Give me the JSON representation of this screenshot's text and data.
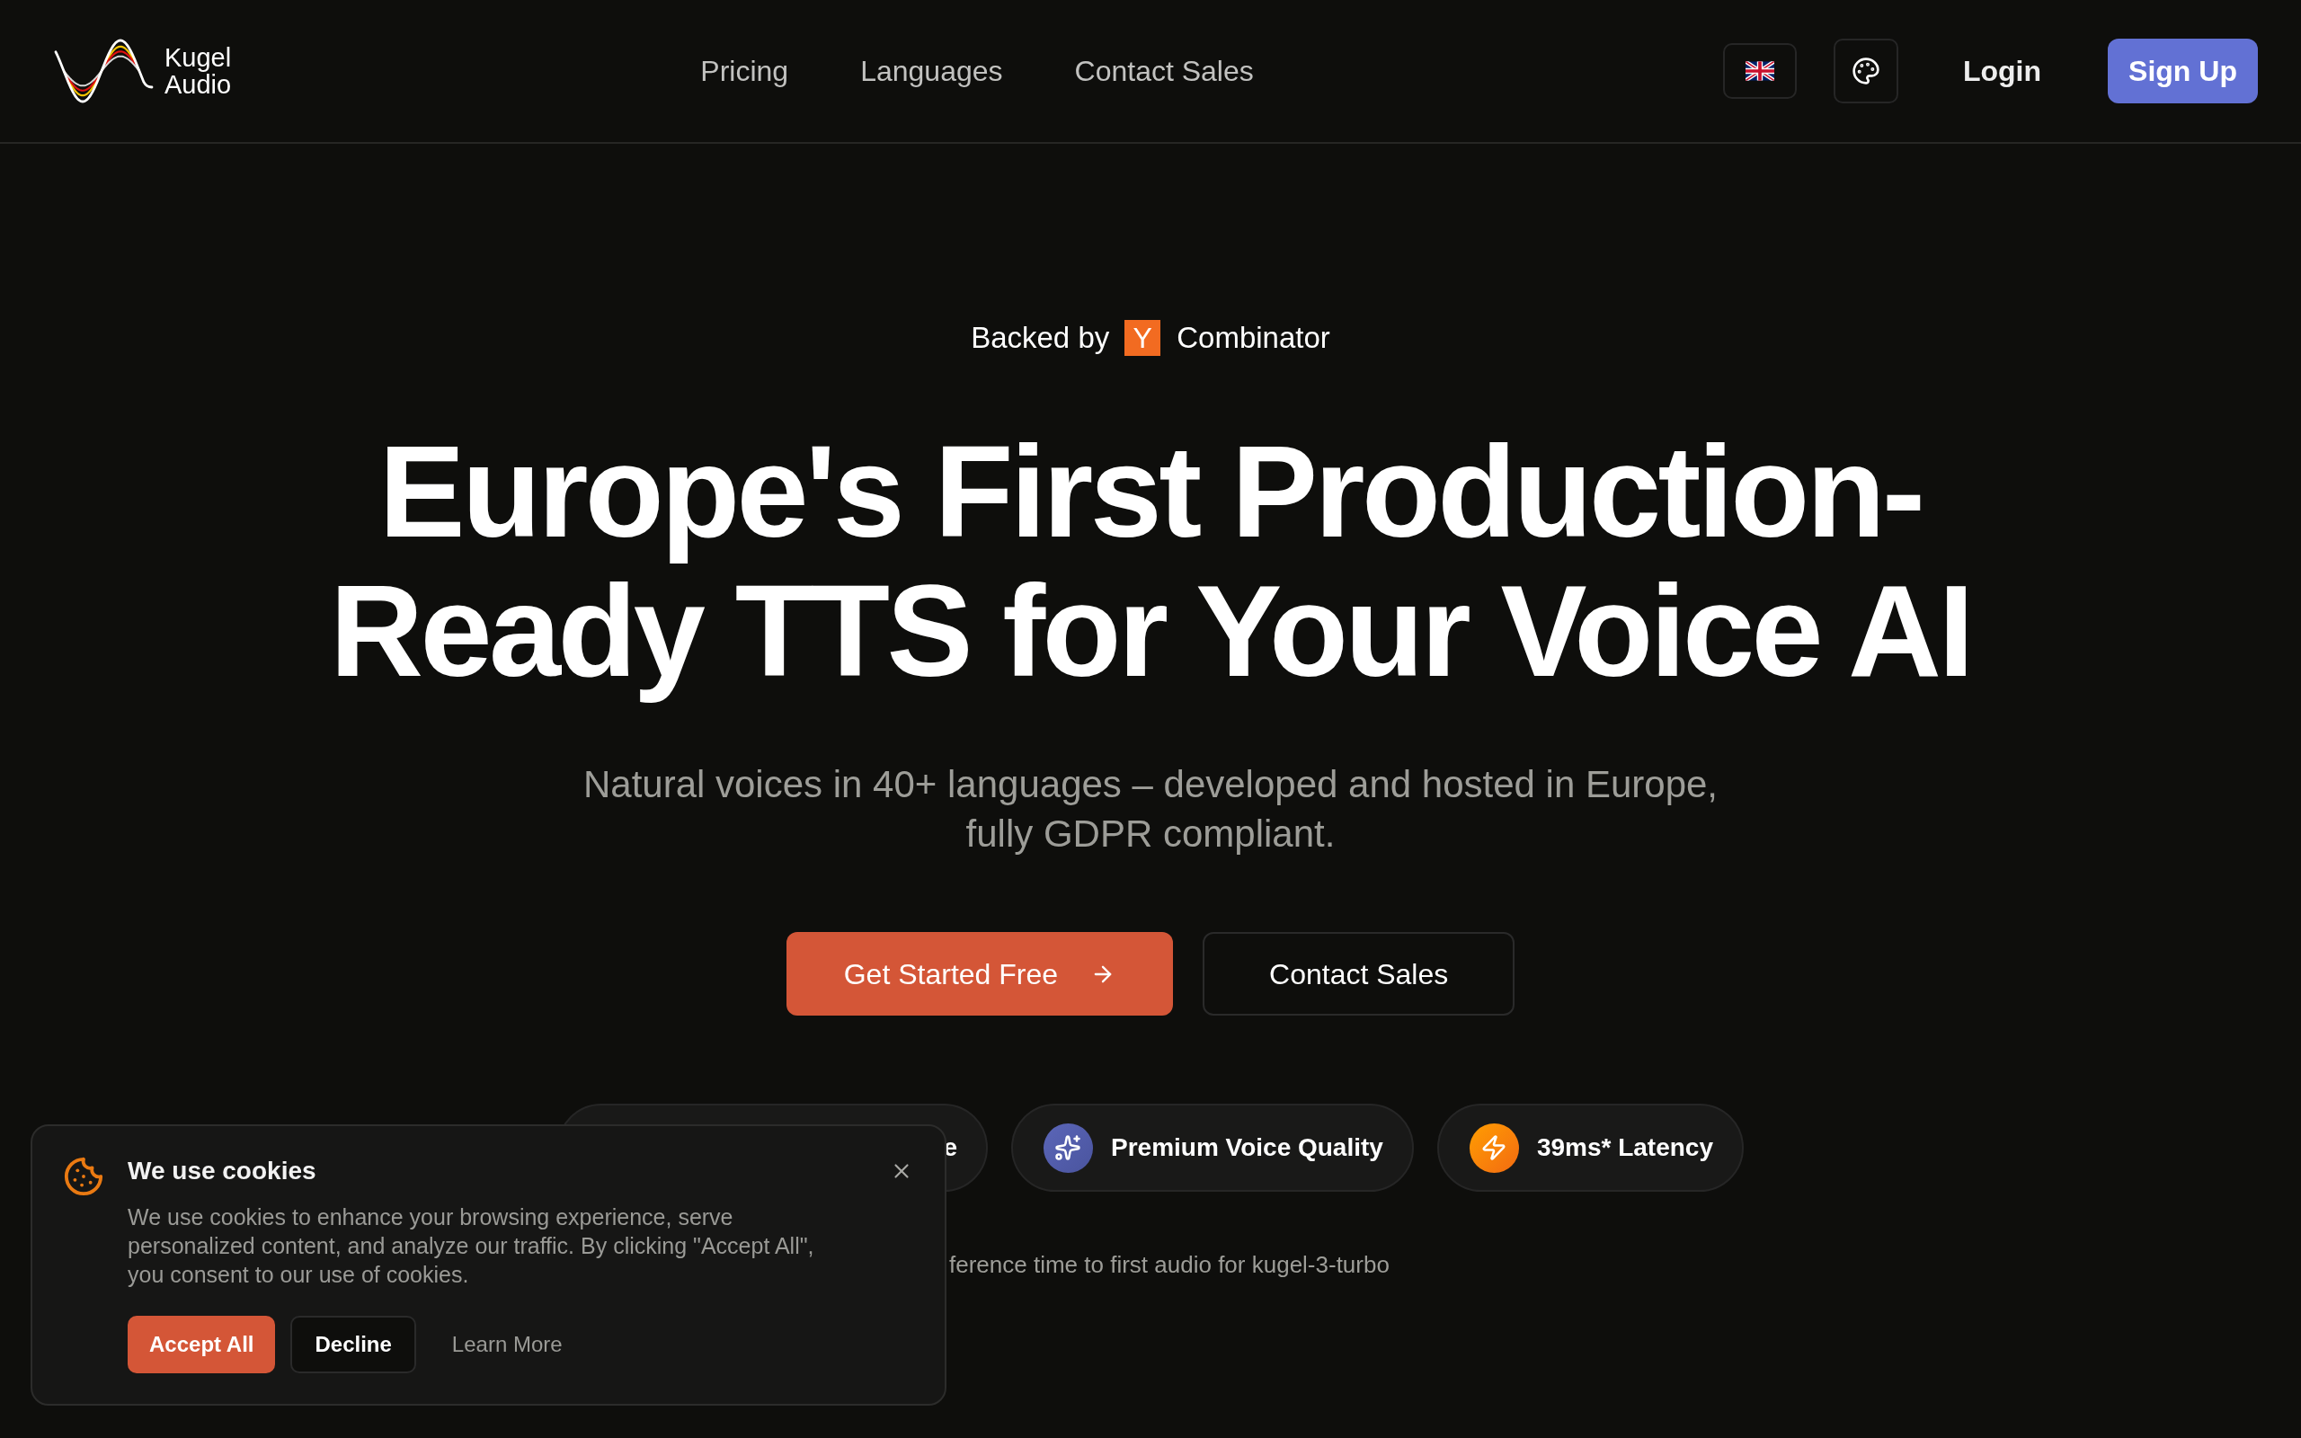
{
  "header": {
    "brand": [
      "Kugel",
      "Audio"
    ],
    "nav": [
      "Pricing",
      "Languages",
      "Contact Sales"
    ],
    "login": "Login",
    "signup": "Sign Up"
  },
  "hero": {
    "backed": {
      "prefix": "Backed by",
      "letter": "Y",
      "suffix": "Combinator"
    },
    "headline": [
      "Europe's First Production-",
      "Ready TTS for Your Voice AI"
    ],
    "subtitle": "Natural voices in 40+ languages – developed and hosted in Europe, fully GDPR compliant.",
    "buttons": [
      {
        "kind": "primary",
        "label": "Get Started Free"
      },
      {
        "kind": "secondary",
        "label": "Contact Sales"
      }
    ],
    "features": [
      {
        "kind": "plain",
        "label": "e"
      },
      {
        "kind": "quality",
        "label": "Premium Voice Quality"
      },
      {
        "kind": "speed",
        "label": "39ms* Latency"
      }
    ],
    "footnote": "ference time to first audio for kugel-3-turbo"
  },
  "cookie_banner": {
    "title": "We use cookies",
    "text": "We use cookies to enhance your browsing experience, serve personalized content, and analyze our traffic. By clicking \"Accept All\", you consent to our use of cookies.",
    "buttons": [
      {
        "kind": "primary",
        "label": "Accept All"
      },
      {
        "kind": "outline",
        "label": "Decline"
      },
      {
        "kind": "link",
        "label": "Learn More"
      }
    ]
  }
}
